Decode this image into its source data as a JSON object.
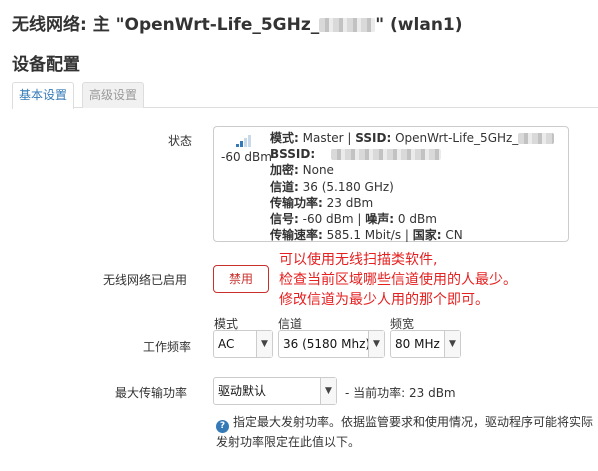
{
  "page": {
    "title_prefix": "无线网络: 主 \"OpenWrt-Life_5GHz_",
    "title_suffix": "\" (wlan1)"
  },
  "section": {
    "title": "设备配置"
  },
  "tabs": [
    {
      "label": "基本设置",
      "active": true
    },
    {
      "label": "高级设置",
      "active": false
    }
  ],
  "status": {
    "label": "状态",
    "signal_dbm": "-60 dBm",
    "signal_bars_filled": 2,
    "signal_bars_total": 4,
    "lines": [
      {
        "k": "模式:",
        "v": " Master | "
      },
      {
        "k": "SSID:",
        "v": " OpenWrt-Life_5GHz_"
      },
      {
        "k": "BSSID:",
        "v": ""
      },
      {
        "k": "加密:",
        "v": " None"
      },
      {
        "k": "信道:",
        "v": " 36 (5.180 GHz)"
      },
      {
        "k": "传输功率:",
        "v": " 23 dBm"
      },
      {
        "k": "信号:",
        "v": " -60 dBm | "
      },
      {
        "k": "噪声:",
        "v": " 0 dBm"
      },
      {
        "k": "传输速率:",
        "v": " 585.1 Mbit/s | "
      },
      {
        "k": "国家:",
        "v": " CN"
      }
    ]
  },
  "wireless_enabled": {
    "label": "无线网络已启用",
    "button_label": "禁用"
  },
  "annotation": {
    "line1": "可以使用无线扫描类软件,",
    "line2": "检查当前区域哪些信道使用的人最少。",
    "line3": "修改信道为最少人用的那个即可。"
  },
  "frequency": {
    "label": "工作频率",
    "mode_label": "模式",
    "channel_label": "信道",
    "width_label": "频宽",
    "mode_value": "AC",
    "channel_value": "36 (5180 Mhz)",
    "width_value": "80 MHz"
  },
  "tx_power": {
    "label": "最大传输功率",
    "value": "驱动默认",
    "current_label": "- 当前功率: 23 dBm",
    "help_text": "指定最大发射功率。依据监管要求和使用情况，驱动程序可能将实际发射功率限定在此值以下。"
  },
  "colors": {
    "accent": "#337ab7",
    "danger": "#c9302c",
    "annotation": "#e52020"
  }
}
